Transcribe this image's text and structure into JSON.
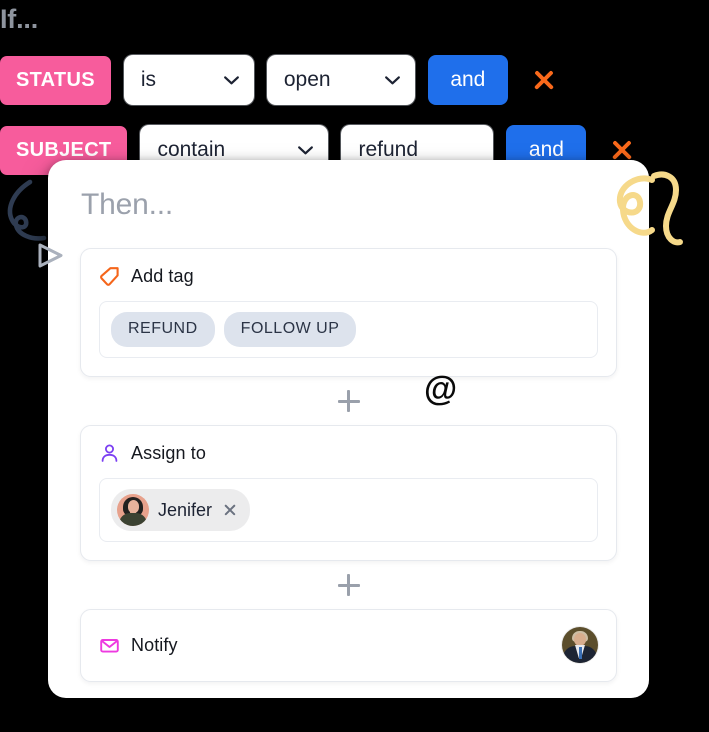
{
  "theme": {
    "background": "#000000",
    "panel_bg": "#ffffff",
    "field_pink": "#f75c9c",
    "and_blue": "#1f6feb",
    "remove_orange": "#f9691b",
    "tag_chip_bg": "#dde3ed",
    "tag_chip_text": "#2b3446",
    "muted_text": "#9ba1ac",
    "tag_icon_orange": "#f5651a",
    "person_icon_purple": "#7b3ff2",
    "mail_icon_magenta": "#ee3ae0",
    "squiggle_yellow": "#f6d98a",
    "squiggle_navy": "#2f3c52"
  },
  "if_section": {
    "label": "If...",
    "conditions": [
      {
        "field": "STATUS",
        "operator": "is",
        "value": "open",
        "join_label": "and",
        "remove_label": "remove-condition"
      },
      {
        "field": "SUBJECT",
        "operator": "contain",
        "value": "refund",
        "join_label": "and",
        "remove_label": "remove-condition"
      }
    ]
  },
  "then_panel": {
    "label": "Then...",
    "actions": [
      {
        "id": "add-tag",
        "icon": "tag-icon",
        "title": "Add tag",
        "tags": [
          "REFUND",
          "FOLLOW UP"
        ]
      },
      {
        "id": "assign-to",
        "icon": "person-icon",
        "title": "Assign to",
        "assignees": [
          {
            "name": "Jenifer",
            "remove_label": "remove-assignee"
          }
        ]
      },
      {
        "id": "notify",
        "icon": "mail-icon",
        "title": "Notify",
        "recipient_avatar": "notify-recipient-avatar"
      }
    ],
    "add_action_label": "+"
  },
  "decorations": {
    "at_symbol": "@",
    "yellow_squiggle": "yellow-squiggle-doodle",
    "navy_squiggle": "navy-squiggle-doodle",
    "triangle_cursor": "triangle-cursor-doodle"
  }
}
